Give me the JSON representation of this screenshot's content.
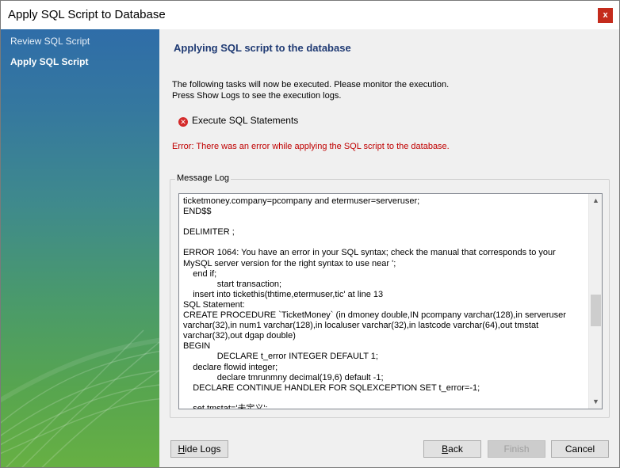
{
  "window": {
    "title": "Apply SQL Script to Database",
    "close_glyph": "x"
  },
  "sidebar": {
    "items": [
      {
        "label": "Review SQL Script",
        "active": false
      },
      {
        "label": "Apply SQL Script",
        "active": true
      }
    ]
  },
  "main": {
    "heading": "Applying SQL script to the database",
    "desc_line1": "The following tasks will now be executed. Please monitor the execution.",
    "desc_line2": "Press Show Logs to see the execution logs.",
    "task": {
      "label": "Execute SQL Statements",
      "status": "error",
      "icon": "error-icon"
    },
    "error": "Error: There was an error while applying the SQL script to the database.",
    "log": {
      "label": "Message Log",
      "text": "ticketmoney.company=pcompany and etermuser=serveruser;\nEND$$\n\nDELIMITER ;\n\nERROR 1064: You have an error in your SQL syntax; check the manual that corresponds to your MySQL server version for the right syntax to use near ';\n    end if;\n              start transaction;\n    insert into tickethis(thtime,etermuser,tic' at line 13\nSQL Statement:\nCREATE PROCEDURE `TicketMoney` (in dmoney double,IN pcompany varchar(128),in serveruser varchar(32),in num1 varchar(128),in localuser varchar(32),in lastcode varchar(64),out tmstat varchar(32),out dgap double)\nBEGIN\n              DECLARE t_error INTEGER DEFAULT 1;\n    declare flowid integer;\n              declare tmrunmny decimal(19,6) default -1;\n    DECLARE CONTINUE HANDLER FOR SQLEXCEPTION SET t_error=-1;\n\n    set tmstat='未定义';"
    }
  },
  "buttons": {
    "hide_logs": {
      "label_u": "H",
      "label_rest": "ide Logs"
    },
    "back": {
      "label_u": "B",
      "label_rest": "ack"
    },
    "finish": {
      "label": "Finish"
    },
    "cancel": {
      "label": "Cancel"
    }
  },
  "colors": {
    "heading": "#1f3a73",
    "error": "#c00000",
    "sidebar_top": "#2f6da8",
    "sidebar_bottom": "#67b043"
  }
}
